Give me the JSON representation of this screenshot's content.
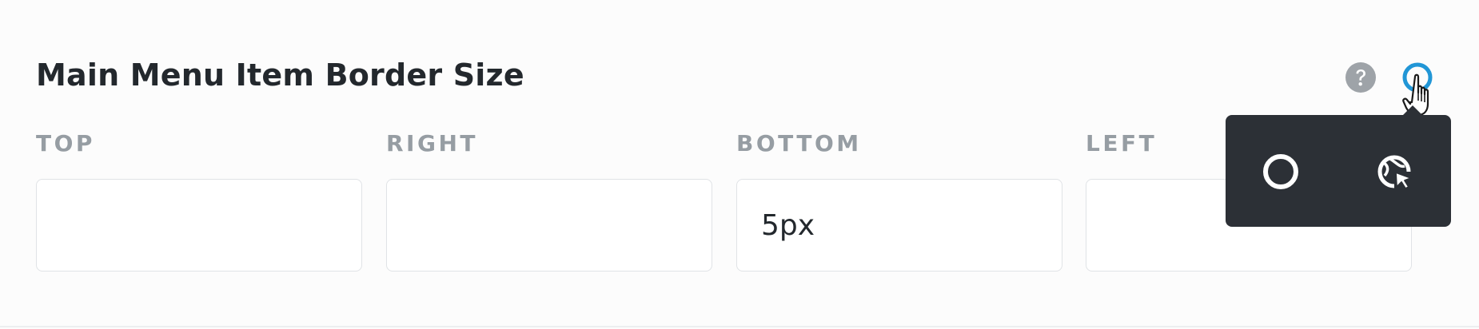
{
  "option": {
    "title": "Main Menu Item Border Size"
  },
  "fields": {
    "top": {
      "label": "TOP",
      "value": "",
      "placeholder": ""
    },
    "right": {
      "label": "RIGHT",
      "value": "",
      "placeholder": ""
    },
    "bottom": {
      "label": "BOTTOM",
      "value": "5px",
      "placeholder": ""
    },
    "left": {
      "label": "LEFT",
      "value": "",
      "placeholder": ""
    }
  },
  "icons": {
    "help": "question-circle-icon",
    "responsive": "state-toggle-circle-icon",
    "cursor": "hand-pointer-icon",
    "state_normal": "circle-outline-icon",
    "state_hover": "cursor-hover-icon"
  },
  "colors": {
    "accent": "#2196d6",
    "popover_bg": "#2c3036",
    "label": "#969da3",
    "title": "#23282d"
  }
}
